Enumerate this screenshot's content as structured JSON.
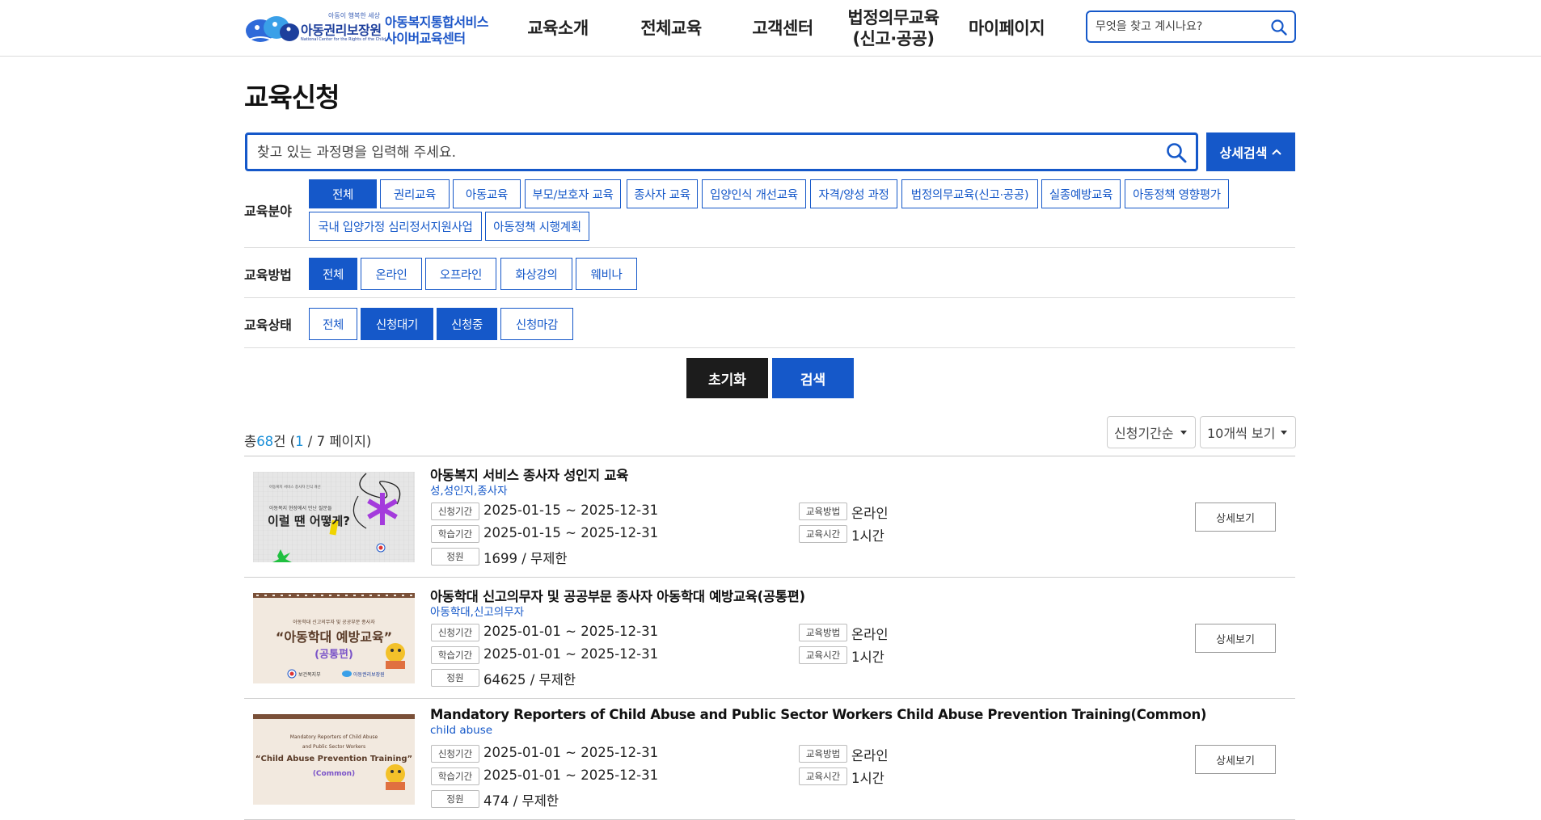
{
  "header": {
    "logo_small": "아동이 행복한 세상",
    "logo_org": "아동권리보장원",
    "logo_en": "National Center for the Rights of the Child",
    "service_line1": "아동복지통합서비스",
    "service_line2": "사이버교육센터",
    "nav": [
      "교육소개",
      "전체교육",
      "고객센터",
      "법정의무교육\n(신고·공공)",
      "마이페이지"
    ],
    "search_placeholder": "무엇을 찾고 계시나요?"
  },
  "page": {
    "title": "교육신청",
    "search_placeholder": "찾고 있는 과정명을 입력해 주세요.",
    "detail_search_label": "상세검색"
  },
  "filters": {
    "field_label": "교육분야",
    "field_options": [
      "전체",
      "권리교육",
      "아동교육",
      "부모/보호자 교육",
      "종사자 교육",
      "입양인식 개선교육",
      "자격/양성 과정",
      "법정의무교육(신고·공공)",
      "실종예방교육",
      "아동정책 영향평가",
      "국내 입양가정 심리정서지원사업",
      "아동정책 시행계획"
    ],
    "method_label": "교육방법",
    "method_options": [
      "전체",
      "온라인",
      "오프라인",
      "화상강의",
      "웨비나"
    ],
    "status_label": "교육상태",
    "status_options": [
      "전체",
      "신청대기",
      "신청중",
      "신청마감"
    ],
    "reset_label": "초기화",
    "search_label": "검색"
  },
  "summary": {
    "prefix": "총",
    "total": "68",
    "suffix": "건 (",
    "page": "1",
    "pages_text": " / 7 페이지)",
    "sort_select": "신청기간순",
    "per_page_select": "10개씩 보기"
  },
  "labels": {
    "apply_period": "신청기간",
    "study_period": "학습기간",
    "capacity": "정원",
    "method": "교육방법",
    "hours": "교육시간",
    "detail": "상세보기"
  },
  "courses": [
    {
      "title": "아동복지 서비스 종사자 성인지 교육",
      "tags": "성,성인지,종사자",
      "apply_period": "2025-01-15 ~ 2025-12-31",
      "study_period": "2025-01-15 ~ 2025-12-31",
      "capacity": "1699 / 무제한",
      "method": "온라인",
      "hours": "1시간",
      "thumb_top": "아동복지 서비스 종사자 인식 개선",
      "thumb_mid": "아동복지 현장에서 만난 질문들",
      "thumb_main": "이럴 땐 어떻게?"
    },
    {
      "title": "아동학대 신고의무자 및 공공부문 종사자 아동학대 예방교육(공통편)",
      "tags": "아동학대,신고의무자",
      "apply_period": "2025-01-01 ~ 2025-12-31",
      "study_period": "2025-01-01 ~ 2025-12-31",
      "capacity": "64625 / 무제한",
      "method": "온라인",
      "hours": "1시간",
      "thumb_top": "아동학대 신고의무자 및 공공부문 종사자",
      "thumb_main": "“아동학대 예방교육”",
      "thumb_sub": "(공통편)",
      "thumb_logo1": "보건복지부",
      "thumb_logo2": "아동권리보장원"
    },
    {
      "title": "Mandatory Reporters of Child Abuse and Public Sector Workers Child Abuse Prevention Training(Common)",
      "tags": "child abuse",
      "apply_period": "2025-01-01 ~ 2025-12-31",
      "study_period": "2025-01-01 ~ 2025-12-31",
      "capacity": "474 / 무제한",
      "method": "온라인",
      "hours": "1시간",
      "thumb_top": "Mandatory Reporters of Child Abuse",
      "thumb_top2": "and Public Sector Workers",
      "thumb_main": "“Child Abuse Prevention Training”",
      "thumb_sub": "(Common)"
    }
  ]
}
